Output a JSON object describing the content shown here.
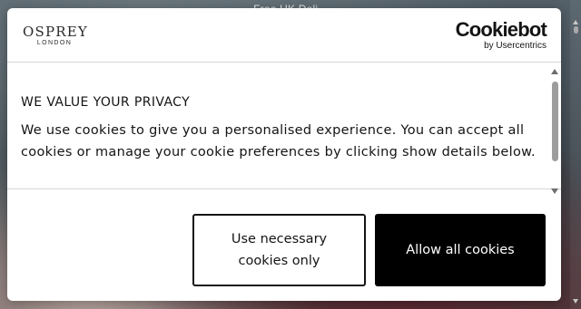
{
  "page": {
    "topbar_text": "Free UK Deli..."
  },
  "dialog": {
    "brand_logo": {
      "main": "OSPREY",
      "sub": "LONDON"
    },
    "provider_logo": {
      "main": "Cookiebot",
      "sub": "by Usercentrics"
    },
    "title": "WE VALUE YOUR PRIVACY",
    "body": "We use cookies to give you a personalised experience. You can accept all cookies or manage your cookie preferences by clicking show details below.",
    "buttons": {
      "necessary_line1": "Use necessary",
      "necessary_line2": "cookies only",
      "allow_all": "Allow all cookies"
    }
  },
  "colors": {
    "dialog_bg": "#ffffff",
    "primary_button_bg": "#000000",
    "primary_button_text": "#ffffff",
    "secondary_button_border": "#141414",
    "text": "#141414"
  },
  "icons": [
    "scroll-up-arrow-icon",
    "scroll-down-arrow-icon"
  ]
}
